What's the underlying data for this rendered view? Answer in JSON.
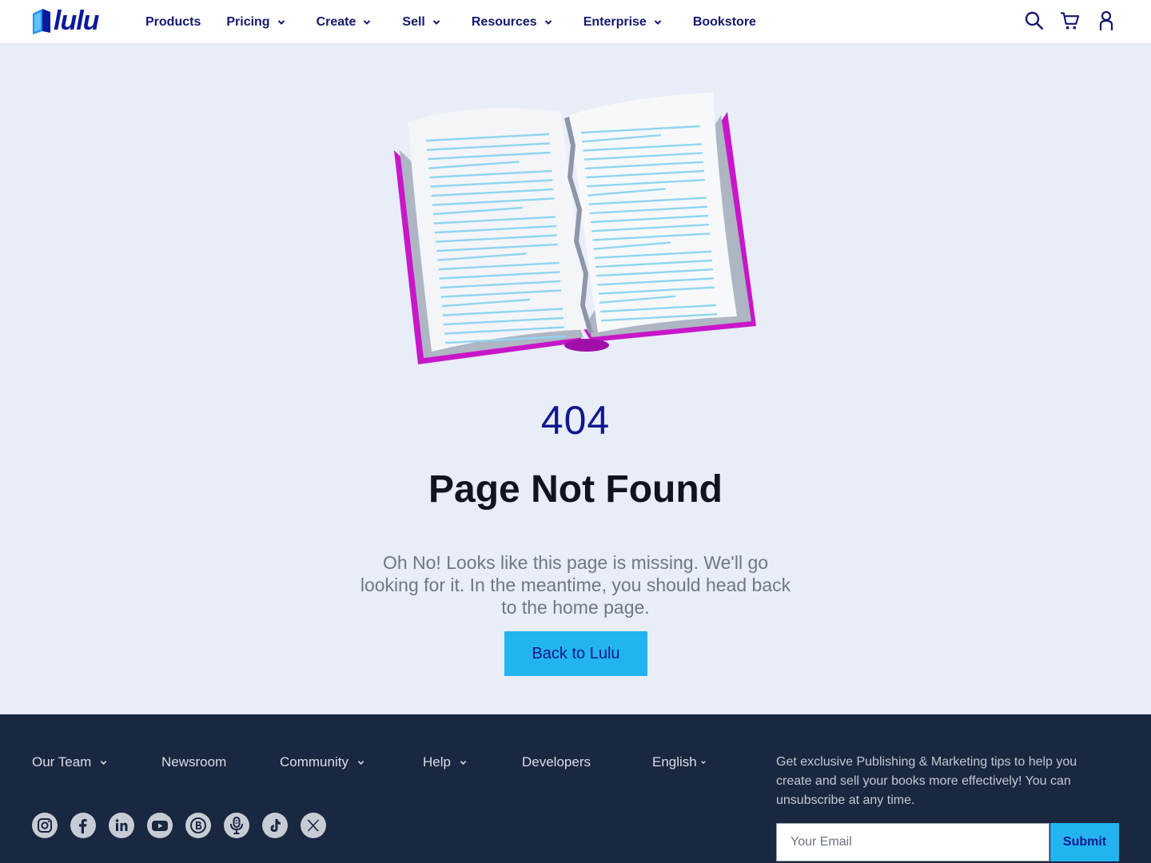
{
  "header": {
    "logo_text": "lulu",
    "nav": [
      {
        "label": "Products",
        "dropdown": false
      },
      {
        "label": "Pricing",
        "dropdown": true
      },
      {
        "label": "Create",
        "dropdown": true
      },
      {
        "label": "Sell",
        "dropdown": true
      },
      {
        "label": "Resources",
        "dropdown": true
      },
      {
        "label": "Enterprise",
        "dropdown": true
      },
      {
        "label": "Bookstore",
        "dropdown": false
      }
    ],
    "icons": [
      "search-icon",
      "cart-icon",
      "account-icon"
    ]
  },
  "main": {
    "code": "404",
    "title": "Page Not Found",
    "description": "Oh No! Looks like this page is missing. We'll go looking for it. In the meantime, you should head back to the home page.",
    "button_label": "Back to Lulu"
  },
  "footer": {
    "links": [
      {
        "label": "Our Team",
        "dropdown": true
      },
      {
        "label": "Newsroom",
        "dropdown": false
      },
      {
        "label": "Community",
        "dropdown": true
      },
      {
        "label": "Help",
        "dropdown": true
      },
      {
        "label": "Developers",
        "dropdown": false
      },
      {
        "label": "English",
        "dropdown": true
      }
    ],
    "socials": [
      "instagram-icon",
      "facebook-icon",
      "linkedin-icon",
      "youtube-icon",
      "blog-icon",
      "podcast-icon",
      "tiktok-icon",
      "x-icon"
    ],
    "promo_text": "Get exclusive Publishing & Marketing tips to help you create and sell your books more effectively! You can unsubscribe at any time.",
    "email_placeholder": "Your Email",
    "submit_label": "Submit"
  },
  "colors": {
    "brand_navy": "#10178f",
    "accent_blue": "#22b4ef",
    "book_magenta": "#c817c8",
    "page_background": "#e8edf7",
    "footer_background": "#1a2740"
  }
}
